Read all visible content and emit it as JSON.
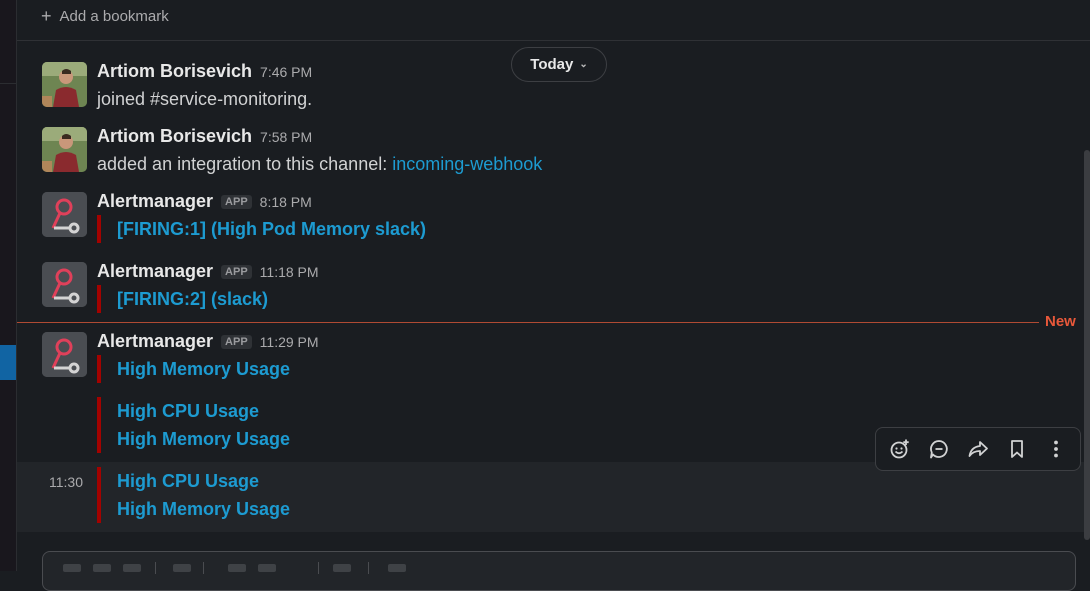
{
  "bookmarks": {
    "add_label": "Add a bookmark",
    "icon": "plus-icon"
  },
  "date_divider": {
    "label": "Today"
  },
  "messages": [
    {
      "sender": "Artiom Borisevich",
      "time": "7:46 PM",
      "text": "joined #service-monitoring."
    },
    {
      "sender": "Artiom Borisevich",
      "time": "7:58 PM",
      "text": "added an integration to this channel: ",
      "link": "incoming-webhook"
    },
    {
      "sender": "Alertmanager",
      "badge": "APP",
      "time": "8:18 PM",
      "alert": "[FIRING:1]  (High Pod Memory slack)"
    },
    {
      "sender": "Alertmanager",
      "badge": "APP",
      "time": "11:18 PM",
      "alert": "[FIRING:2]  (slack)"
    },
    {
      "sender": "Alertmanager",
      "badge": "APP",
      "time": "11:29 PM",
      "alert": "High Memory Usage"
    }
  ],
  "continuations": [
    {
      "lines": [
        "High CPU Usage",
        "High Memory Usage"
      ]
    },
    {
      "time": "11:30",
      "lines": [
        "High CPU Usage",
        "High Memory Usage"
      ]
    }
  ],
  "new_divider": {
    "label": "New"
  },
  "message_toolbar": {
    "icons": [
      "add-reaction-icon",
      "reply-in-thread-icon",
      "share-icon",
      "bookmark-icon",
      "more-actions-icon"
    ]
  },
  "colors": {
    "link": "#1d9bd1",
    "alert_bar": "#a30200",
    "new_divider": "#e8583a",
    "background": "#1a1d21"
  }
}
